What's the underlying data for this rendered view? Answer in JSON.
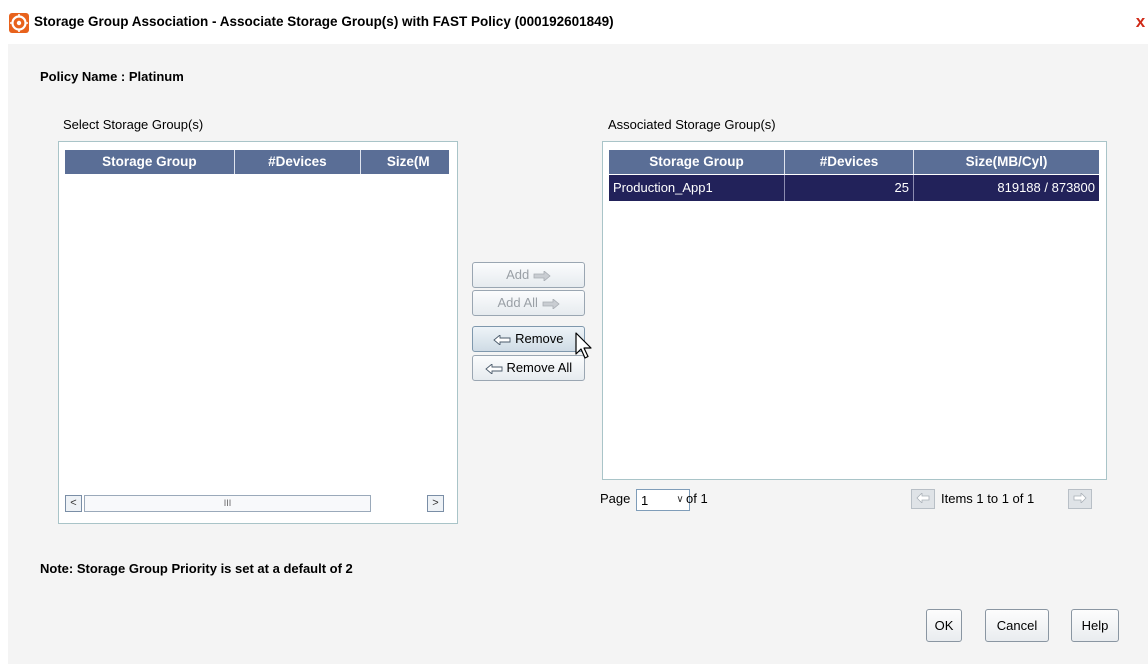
{
  "window": {
    "title": "Storage Group Association - Associate Storage Group(s) with FAST Policy (000192601849)",
    "close_glyph": "x",
    "app_icon": "emc-app-icon"
  },
  "policy": {
    "text": "Policy Name : Platinum"
  },
  "left_panel": {
    "label": "Select Storage Group(s)",
    "columns": [
      "Storage Group",
      "#Devices",
      "Size(M"
    ],
    "rows": [],
    "scrollbar": {
      "left_arrow": "<",
      "thumb_grip": "III",
      "right_arrow": ">"
    }
  },
  "right_panel": {
    "label": "Associated Storage Group(s)",
    "columns": [
      "Storage Group",
      "#Devices",
      "Size(MB/Cyl)"
    ],
    "rows": [
      {
        "storage_group": "Production_App1",
        "devices": "25",
        "size": "819188 / 873800",
        "selected": true
      }
    ]
  },
  "move_buttons": {
    "add": "Add",
    "add_all": "Add All",
    "remove": "Remove",
    "remove_all": "Remove All"
  },
  "pager": {
    "page_label": "Page",
    "page_value": "1",
    "of_label": "of 1",
    "items_text": "Items 1 to 1 of 1"
  },
  "note": "Note: Storage Group Priority is set at a default of 2",
  "footer": {
    "ok": "OK",
    "cancel": "Cancel",
    "help": "Help"
  },
  "colors": {
    "grid_header": "#5a6e96",
    "selected_row": "#22225a",
    "panel_border": "#a9c4c8",
    "close": "#d02a18",
    "app_icon": "#e8621c"
  }
}
